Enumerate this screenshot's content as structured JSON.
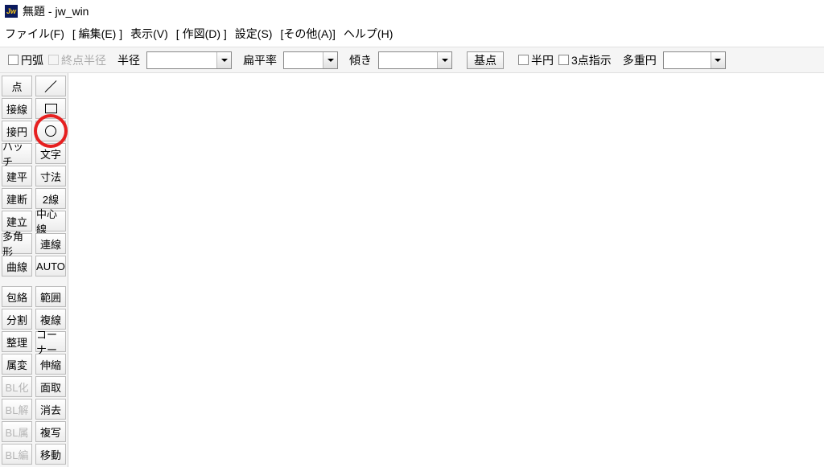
{
  "title": {
    "icon_text": "Jw",
    "document": "無題",
    "app": "jw_win"
  },
  "menu": {
    "file": "ファイル(F)",
    "edit": "[ 編集(E) ]",
    "view": "表示(V)",
    "draw": "[ 作図(D) ]",
    "settings": "設定(S)",
    "other": "[その他(A)]",
    "help": "ヘルプ(H)"
  },
  "options": {
    "arc": "円弧",
    "end_radius": "終点半径",
    "radius": "半径",
    "flatness": "扁平率",
    "tilt": "傾き",
    "base_point": "基点",
    "semicircle": "半円",
    "three_point": "3点指示",
    "multi_circle": "多重円"
  },
  "tools": {
    "left": [
      "点",
      "接線",
      "接円",
      "ハッチ",
      "建平",
      "建断",
      "建立",
      "多角形",
      "曲線"
    ],
    "left2": [
      "包絡",
      "分割",
      "整理",
      "属変",
      "BL化",
      "BL解",
      "BL属",
      "BL編"
    ],
    "right": [
      "文字",
      "寸法",
      "2線",
      "中心線",
      "連線",
      "AUTO"
    ],
    "right2": [
      "範囲",
      "複線",
      "コーナー",
      "伸縮",
      "面取",
      "消去",
      "複写",
      "移動"
    ]
  },
  "icon_names": {
    "line": "line",
    "square": "square",
    "circle": "circle"
  }
}
